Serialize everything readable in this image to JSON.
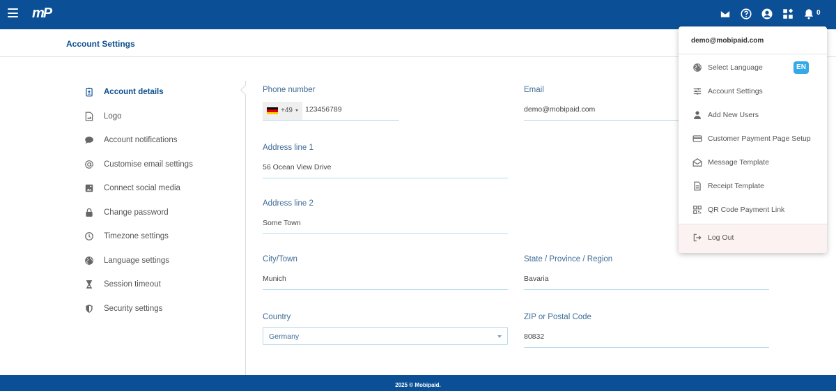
{
  "app": {
    "logo_text": "mP"
  },
  "topbar": {
    "icons": [
      "mail-icon",
      "help-icon",
      "account-circle-icon",
      "apps-icon",
      "bell-icon"
    ],
    "notification_count": "0"
  },
  "header": {
    "title": "Account Settings"
  },
  "sidebar": {
    "items": [
      {
        "label": "Account details",
        "icon": "id-badge-icon",
        "active": true
      },
      {
        "label": "Logo",
        "icon": "image-icon"
      },
      {
        "label": "Account notifications",
        "icon": "chat-bubble-icon"
      },
      {
        "label": "Customise email settings",
        "icon": "at-sign-icon"
      },
      {
        "label": "Connect social media",
        "icon": "picture-icon"
      },
      {
        "label": "Change password",
        "icon": "lock-icon"
      },
      {
        "label": "Timezone settings",
        "icon": "clock-icon"
      },
      {
        "label": "Language settings",
        "icon": "globe-icon"
      },
      {
        "label": "Session timeout",
        "icon": "hourglass-icon"
      },
      {
        "label": "Security settings",
        "icon": "shield-icon"
      }
    ]
  },
  "form": {
    "phone": {
      "label": "Phone number",
      "dial_code": "+49",
      "value": "123456789",
      "flag": "germany-flag-icon"
    },
    "email": {
      "label": "Email",
      "value": "demo@mobipaid.com"
    },
    "address1": {
      "label": "Address line 1",
      "value": "56 Ocean View Drive"
    },
    "address2": {
      "label": "Address line 2",
      "value": "Some Town"
    },
    "city": {
      "label": "City/Town",
      "value": "Munich"
    },
    "state": {
      "label": "State / Province / Region",
      "value": "Bavaria"
    },
    "country": {
      "label": "Country",
      "value": "Germany"
    },
    "zip": {
      "label": "ZIP or Postal Code",
      "value": "80832"
    }
  },
  "menu": {
    "email": "demo@mobipaid.com",
    "language_badge": "EN",
    "items": [
      {
        "label": "Select Language",
        "icon": "globe-icon"
      },
      {
        "label": "Account Settings",
        "icon": "sliders-icon"
      },
      {
        "label": "Add New Users",
        "icon": "user-icon"
      },
      {
        "label": "Customer Payment Page Setup",
        "icon": "credit-card-icon"
      },
      {
        "label": "Message Template",
        "icon": "envelope-open-icon"
      },
      {
        "label": "Receipt Template",
        "icon": "document-icon"
      },
      {
        "label": "QR Code Payment Link",
        "icon": "qr-code-icon"
      }
    ],
    "logout": {
      "label": "Log Out",
      "icon": "logout-icon"
    }
  },
  "footer": {
    "text": "2025 © Mobipaid."
  },
  "colors": {
    "brand": "#0b5096",
    "accent": "#33a9e8",
    "label": "#3f6c96"
  }
}
